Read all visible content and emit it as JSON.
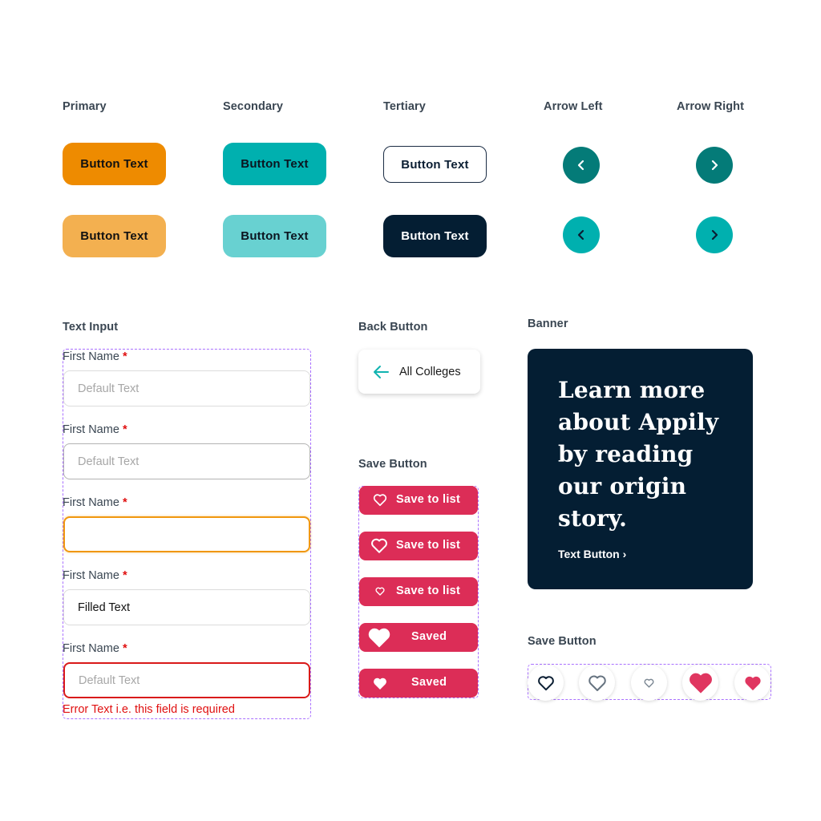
{
  "colors": {
    "primary": "#ee8b00",
    "primary_light": "#f3b050",
    "secondary": "#00b0af",
    "secondary_light": "#68d1d1",
    "navy": "#041e33",
    "teal_dark": "#047b78",
    "save_red": "#dc2d57",
    "error_red": "#e01010",
    "focus_orange": "#f0970f",
    "guide_purple": "#a970ff"
  },
  "buttons": {
    "primary_label": "Primary",
    "secondary_label": "Secondary",
    "tertiary_label": "Tertiary",
    "arrow_left_label": "Arrow Left",
    "arrow_right_label": "Arrow Right",
    "button_text": "Button Text",
    "arrow_left_icon": "chevron-left-icon",
    "arrow_right_icon": "chevron-right-icon"
  },
  "text_input": {
    "section_label": "Text Input",
    "fields": [
      {
        "label": "First Name",
        "required_mark": "*",
        "state": "default",
        "placeholder": "Default Text",
        "value": ""
      },
      {
        "label": "First Name",
        "required_mark": "*",
        "state": "hover",
        "placeholder": "Default Text",
        "value": ""
      },
      {
        "label": "First Name",
        "required_mark": "*",
        "state": "focus",
        "placeholder": "",
        "value": ""
      },
      {
        "label": "First Name",
        "required_mark": "*",
        "state": "filled",
        "placeholder": "",
        "value": "Filled Text"
      },
      {
        "label": "First Name",
        "required_mark": "*",
        "state": "error",
        "placeholder": "Default Text",
        "value": ""
      }
    ],
    "error_text": "Error Text i.e. this field is required"
  },
  "back_button": {
    "section_label": "Back Button",
    "label": "All Colleges",
    "icon": "arrow-left-icon"
  },
  "save_button_pills": {
    "section_label": "Save Button",
    "items": [
      {
        "label": "Save to list",
        "icon": "heart-outline-icon",
        "state": "default"
      },
      {
        "label": "Save to list",
        "icon": "heart-outline-icon",
        "state": "hover"
      },
      {
        "label": "Save to list",
        "icon": "heart-outline-small-icon",
        "state": "pressed"
      },
      {
        "label": "Saved",
        "icon": "heart-filled-large-icon",
        "state": "saved-hover"
      },
      {
        "label": "Saved",
        "icon": "heart-filled-icon",
        "state": "saved"
      }
    ]
  },
  "banner": {
    "section_label": "Banner",
    "title": "Learn more about Appily by reading our origin story.",
    "link_text": "Text Button ›"
  },
  "save_button_circles": {
    "section_label": "Save Button",
    "items": [
      {
        "icon": "heart-outline-icon",
        "state": "default"
      },
      {
        "icon": "heart-outline-icon",
        "state": "hover"
      },
      {
        "icon": "heart-outline-small-icon",
        "state": "pressed"
      },
      {
        "icon": "heart-filled-large-icon",
        "state": "saved-hover"
      },
      {
        "icon": "heart-filled-icon",
        "state": "saved"
      }
    ]
  }
}
